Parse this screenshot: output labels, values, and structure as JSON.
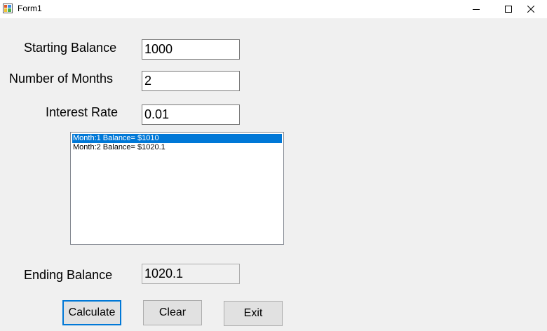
{
  "window": {
    "title": "Form1",
    "icon": "winforms-app-icon",
    "controls": [
      "minimize-icon",
      "maximize-icon",
      "close-icon"
    ]
  },
  "form": {
    "starting_balance": {
      "label": "Starting Balance",
      "value": "1000"
    },
    "number_of_months": {
      "label": "Number of Months",
      "value": "2"
    },
    "interest_rate": {
      "label": "Interest Rate",
      "value": "0.01"
    },
    "results": [
      "Month:1 Balance= $1010",
      "Month:2 Balance= $1020.1"
    ],
    "selected_result_index": 0,
    "ending_balance": {
      "label": "Ending Balance",
      "value": "1020.1"
    }
  },
  "buttons": {
    "calculate": "Calculate",
    "clear": "Clear",
    "exit": "Exit"
  },
  "colors": {
    "selection": "#0078d7",
    "default_button_border": "#0078d7",
    "form_background": "#f0f0f0"
  }
}
